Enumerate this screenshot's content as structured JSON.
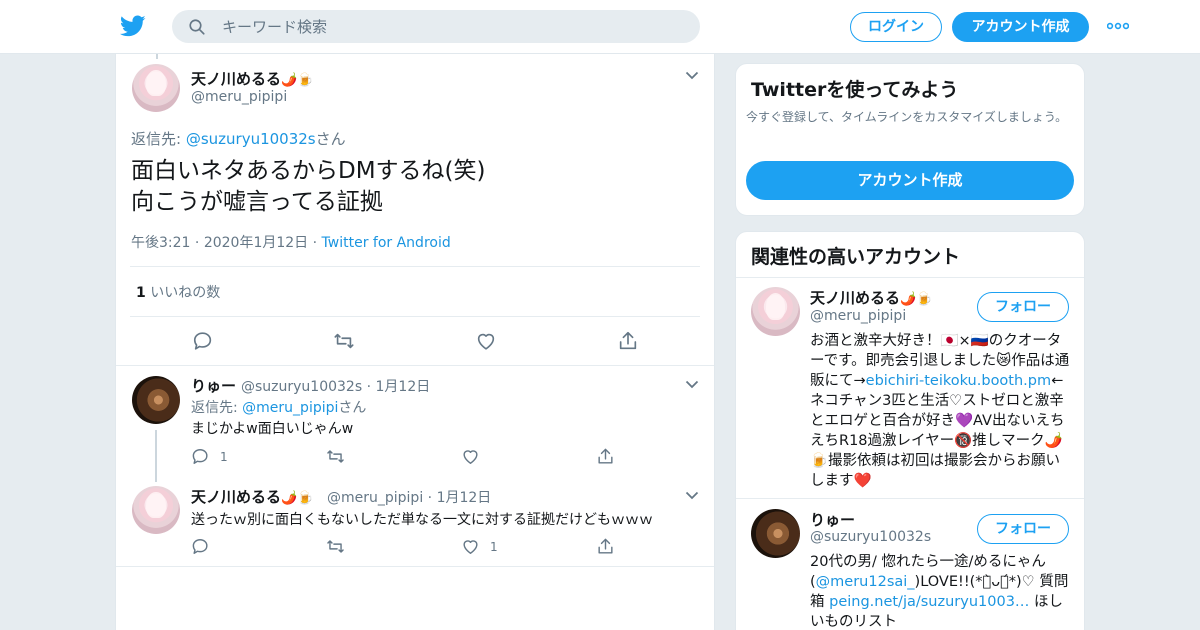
{
  "header": {
    "search_placeholder": "キーワード検索",
    "login_label": "ログイン",
    "signup_label": "アカウント作成"
  },
  "main_tweet": {
    "display_name": "天ノ川めるる",
    "name_emoji": "🌶️🍺",
    "handle": "@meru_pipipi",
    "reply_prefix": "返信先: ",
    "reply_handle": "@suzuryu10032s",
    "reply_suffix": "さん",
    "text_line1": "面白いネタあるからDMするね(笑)",
    "text_line2": "向こうが嘘言ってる証拠",
    "time": "午後3:21",
    "date": "2020年1月12日",
    "source": "Twitter for Android",
    "like_count": "1",
    "like_label": "いいねの数"
  },
  "replies": [
    {
      "display_name": "りゅー",
      "handle": "@suzuryu10032s",
      "date": "1月12日",
      "reply_prefix": "返信先: ",
      "reply_handle": "@meru_pipipi",
      "reply_suffix": "さん",
      "text": "まじかよw面白いじゃんw",
      "reply_count": "1",
      "like_count": ""
    },
    {
      "display_name": "天ノ川めるる",
      "name_emoji": "🌶️🍺",
      "handle": "@meru_pipipi",
      "date": "1月12日",
      "text": "送ったｗ別に面白くもないしただ単なる一文に対する証拠だけどもｗｗｗ",
      "reply_count": "",
      "like_count": "1"
    }
  ],
  "sidebar": {
    "try_card": {
      "title": "Twitterを使ってみよう",
      "subtitle": "今すぐ登録して、タイムラインをカスタマイズしましょう。",
      "button_label": "アカウント作成"
    },
    "related": {
      "title": "関連性の高いアカウント",
      "accounts": [
        {
          "display_name": "天ノ川めるる",
          "name_emoji": "🌶️🍺",
          "handle": "@meru_pipipi",
          "follow_label": "フォロー",
          "bio_1": "お酒と激辛大好き！🇯🇵×🇷🇺のクオーターです。即売会引退しました😿作品は通販にて→",
          "bio_link": "ebichiri-teikoku.booth.pm",
          "bio_2": "←ネコチャン3匹と生活♡ストゼロと激辛とエロゲと百合が好き💜AV出ないえちえちR18過激レイヤー🔞推しマーク🌶️🍺撮影依頼は初回は撮影会からお願いします❤️"
        },
        {
          "display_name": "りゅー",
          "handle": "@suzuryu10032s",
          "follow_label": "フォロー",
          "bio_1": "20代の男/ 惚れたら一途/めるにゃん(",
          "bio_link": "@meru12sai_",
          "bio_2": ")LOVE!!(*ค̀ᴗค́*)♡ 質問箱 ",
          "bio_link2": "peing.net/ja/suzuryu1003…",
          "bio_3": " ほしいものリスト"
        }
      ]
    }
  },
  "colors": {
    "accent": "#1da1f2",
    "link": "#1b95e0",
    "muted": "#657786",
    "background": "#e6ecf0"
  }
}
